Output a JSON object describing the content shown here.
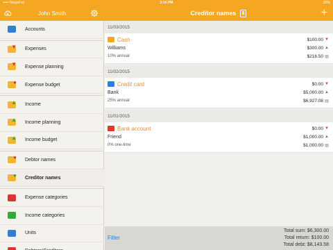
{
  "status": {
    "carrier": "••••• MegaFon",
    "time": "3:14 PM",
    "battery": "93%"
  },
  "sidebar": {
    "user_name": "John Smith",
    "items": [
      {
        "label": "Accounts",
        "icon": "accounts-icon",
        "color": "#2f7fd6",
        "mark": "",
        "markColor": ""
      },
      {
        "label": "Expenses",
        "icon": "expenses-icon",
        "color": "#f2b531",
        "mark": "▼",
        "markColor": "#d33"
      },
      {
        "label": "Expense planning",
        "icon": "expense-planning-icon",
        "color": "#f2b531",
        "mark": "▼",
        "markColor": "#d33"
      },
      {
        "label": "Expense budget",
        "icon": "expense-budget-icon",
        "color": "#f2b531",
        "mark": "●",
        "markColor": "#d33"
      },
      {
        "label": "Income",
        "icon": "income-icon",
        "color": "#f2b531",
        "mark": "▲",
        "markColor": "#3a3"
      },
      {
        "label": "Income planning",
        "icon": "income-planning-icon",
        "color": "#f2b531",
        "mark": "▲",
        "markColor": "#3a3"
      },
      {
        "label": "Income budget",
        "icon": "income-budget-icon",
        "color": "#f2b531",
        "mark": "▲",
        "markColor": "#3a3"
      },
      {
        "label": "Debtor names",
        "icon": "debtor-names-icon",
        "color": "#f2b531",
        "mark": "●",
        "markColor": "#d33"
      },
      {
        "label": "Creditor names",
        "icon": "creditor-names-icon",
        "color": "#f2b531",
        "mark": "●",
        "markColor": "#3a3"
      },
      {
        "label": "Expense categories",
        "icon": "expense-categories-icon",
        "color": "#d33",
        "mark": "",
        "markColor": ""
      },
      {
        "label": "Income categories",
        "icon": "income-categories-icon",
        "color": "#3a3",
        "mark": "",
        "markColor": ""
      },
      {
        "label": "Units",
        "icon": "units-icon",
        "color": "#2f7fd6",
        "mark": "",
        "markColor": ""
      },
      {
        "label": "Debtors/Creditors",
        "icon": "debtors-creditors-icon",
        "color": "#d33",
        "mark": "",
        "markColor": ""
      }
    ],
    "active_index": 8
  },
  "header": {
    "title": "Creditor names",
    "currency_badge": "$",
    "add_label": "+"
  },
  "groups": [
    {
      "date": "11/03/2015",
      "account": "Cash",
      "account_icon": "cash-icon",
      "account_color": "#f5a623",
      "creditor": "Williams",
      "rate": "10% annual",
      "amounts": [
        {
          "value": "$100.00",
          "mark": "▼",
          "type": "red"
        },
        {
          "value": "$300.00",
          "mark": "▲",
          "type": "green"
        },
        {
          "value": "$216.50",
          "mark": "▤",
          "type": "cal"
        }
      ]
    },
    {
      "date": "11/02/2015",
      "account": "Credit card",
      "account_icon": "credit-card-icon",
      "account_color": "#2f7fd6",
      "creditor": "Bank",
      "rate": "25% annual",
      "amounts": [
        {
          "value": "$0.00",
          "mark": "▼",
          "type": "red"
        },
        {
          "value": "$5,000.00",
          "mark": "▲",
          "type": "green"
        },
        {
          "value": "$6,927.08",
          "mark": "▤",
          "type": "cal"
        }
      ]
    },
    {
      "date": "11/01/2015",
      "account": "Bank account",
      "account_icon": "bank-account-icon",
      "account_color": "#e23a2a",
      "creditor": "Friend",
      "rate": "0% one-time",
      "amounts": [
        {
          "value": "$0.00",
          "mark": "▼",
          "type": "red"
        },
        {
          "value": "$1,000.00",
          "mark": "▲",
          "type": "green"
        },
        {
          "value": "$1,000.00",
          "mark": "▤",
          "type": "cal"
        }
      ]
    }
  ],
  "footer": {
    "filter_label": "Filter",
    "total_sum": "Total sum: $6,300.00",
    "total_return": "Total return: $100.00",
    "total_debt": "Total debt: $8,143.58"
  }
}
